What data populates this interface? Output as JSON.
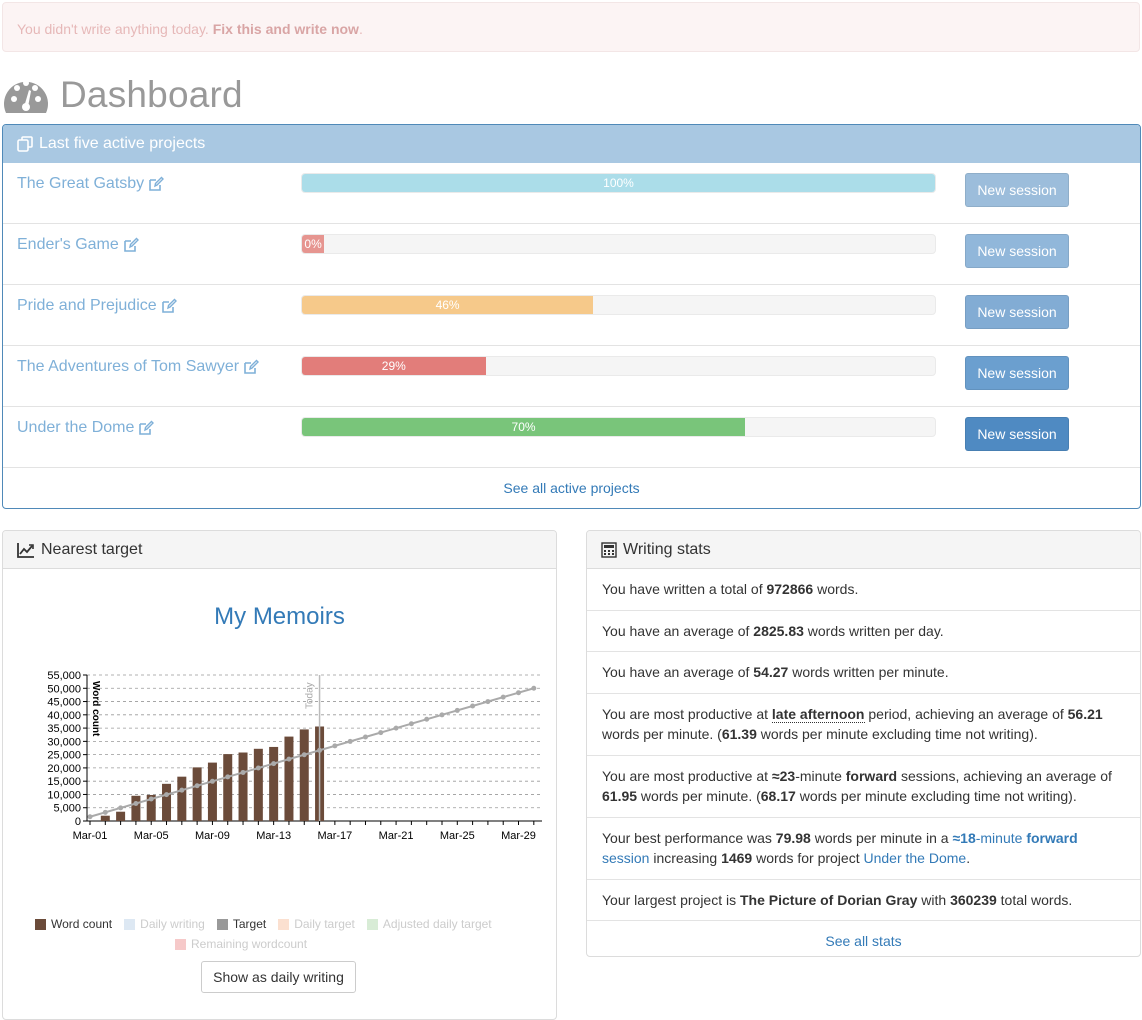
{
  "alert": {
    "text": "You didn't write anything today.",
    "link": "Fix this and write now",
    "suffix": "."
  },
  "page_title": "Dashboard",
  "projects_panel": {
    "title": "Last five active projects",
    "see_all": "See all active projects",
    "items": [
      {
        "name": "The Great Gatsby",
        "progress": 100,
        "label": "100%",
        "color": "#abdde9",
        "button": "New session",
        "button_color": "#9cbddb"
      },
      {
        "name": "Ender's Game",
        "progress": 0,
        "label": "0%",
        "color": "#e69590",
        "button": "New session",
        "button_color": "#91b7da"
      },
      {
        "name": "Pride and Prejudice",
        "progress": 46,
        "label": "46%",
        "color": "#f6c98a",
        "button": "New session",
        "button_color": "#82acd4"
      },
      {
        "name": "The Adventures of Tom Sawyer",
        "progress": 29,
        "label": "29%",
        "color": "#e27d7a",
        "button": "New session",
        "button_color": "#6b9fcf"
      },
      {
        "name": "Under the Dome",
        "progress": 70,
        "label": "70%",
        "color": "#79c57a",
        "button": "New session",
        "button_color": "#4f8ac2"
      }
    ]
  },
  "target_panel": {
    "title": "Nearest target",
    "button": "Show as daily writing",
    "legend": [
      {
        "label": "Word count",
        "color": "#6b4b3a",
        "active": true
      },
      {
        "label": "Daily writing",
        "color": "#dde8f3",
        "active": false
      },
      {
        "label": "Target",
        "color": "#999999",
        "active": true
      },
      {
        "label": "Daily target",
        "color": "#fbe0d0",
        "active": false
      },
      {
        "label": "Adjusted daily target",
        "color": "#d8ecd6",
        "active": false
      },
      {
        "label": "Remaining wordcount",
        "color": "#f6c9c9",
        "active": false
      }
    ]
  },
  "chart_data": {
    "type": "bar",
    "title": "My Memoirs",
    "ylabel": "Word count",
    "ylim": [
      0,
      55000
    ],
    "y_ticks": [
      "0",
      "5,000",
      "10,000",
      "15,000",
      "20,000",
      "25,000",
      "30,000",
      "35,000",
      "40,000",
      "45,000",
      "50,000",
      "55,000"
    ],
    "x_ticks": [
      "Mar-01",
      "Mar-05",
      "Mar-09",
      "Mar-13",
      "Mar-17",
      "Mar-21",
      "Mar-25",
      "Mar-29"
    ],
    "today_label": "Today",
    "series": [
      {
        "name": "Word count",
        "type": "bar",
        "color": "#6b4b3a",
        "x": [
          "Mar-02",
          "Mar-03",
          "Mar-04",
          "Mar-05",
          "Mar-06",
          "Mar-07",
          "Mar-08",
          "Mar-09",
          "Mar-10",
          "Mar-11",
          "Mar-12",
          "Mar-13",
          "Mar-14",
          "Mar-15",
          "Mar-16"
        ],
        "values": [
          2000,
          3500,
          9500,
          9800,
          14000,
          16700,
          20200,
          22000,
          25200,
          25800,
          27200,
          27900,
          31800,
          34500,
          35600
        ]
      },
      {
        "name": "Target",
        "type": "line",
        "color": "#aaaaaa",
        "x_start": "Mar-01",
        "x_end": "Mar-30",
        "start": 1600,
        "end": 50000
      }
    ]
  },
  "stats_panel": {
    "title": "Writing stats",
    "see_all": "See all stats",
    "total_words": "972866",
    "avg_per_day": "2825.83",
    "avg_per_minute": "54.27",
    "productive_period": "late afternoon",
    "period_avg": "56.21",
    "period_avg_excl": "61.39",
    "session_length": "≈23",
    "session_type": "forward",
    "session_avg": "61.95",
    "session_avg_excl": "68.17",
    "best_perf": "79.98",
    "best_session_length": "≈18",
    "best_session_type": "forward",
    "best_words": "1469",
    "best_project": "Under the Dome",
    "largest_project": "The Picture of Dorian Gray",
    "largest_words": "360239"
  }
}
